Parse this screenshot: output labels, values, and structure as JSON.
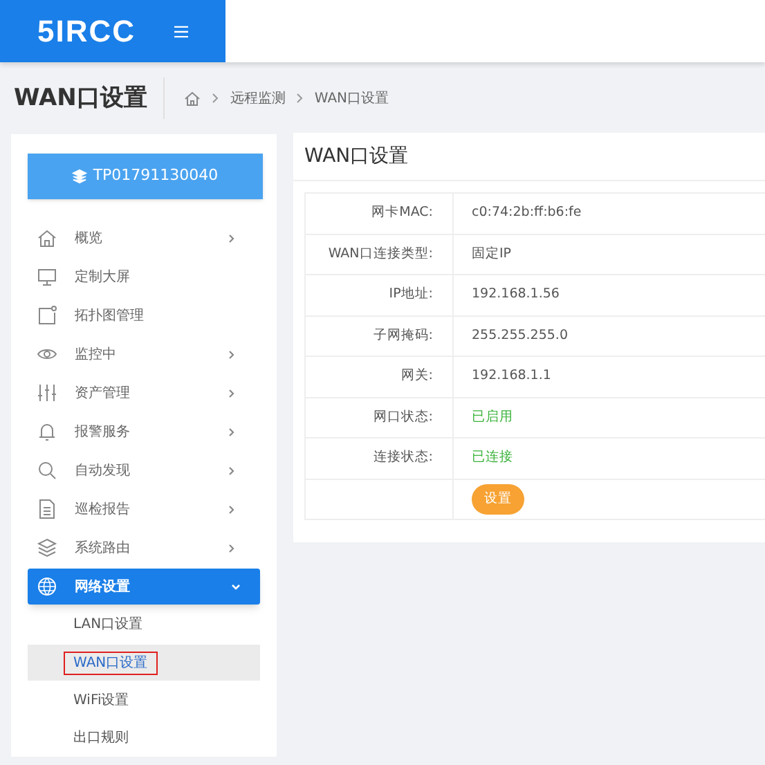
{
  "header": {
    "logo": "5IRCC"
  },
  "page_title": "WAN口设置",
  "breadcrumb": [
    "远程监测",
    "WAN口设置"
  ],
  "device_button": "TP01791130040",
  "sidebar": {
    "items": [
      {
        "label": "概览",
        "has_arrow": true,
        "expanded": false
      },
      {
        "label": "定制大屏",
        "has_arrow": false,
        "expanded": false
      },
      {
        "label": "拓扑图管理",
        "has_arrow": false,
        "expanded": false
      },
      {
        "label": "监控中",
        "has_arrow": true,
        "expanded": false
      },
      {
        "label": "资产管理",
        "has_arrow": true,
        "expanded": false
      },
      {
        "label": "报警服务",
        "has_arrow": true,
        "expanded": false
      },
      {
        "label": "自动发现",
        "has_arrow": true,
        "expanded": false
      },
      {
        "label": "巡检报告",
        "has_arrow": true,
        "expanded": false
      },
      {
        "label": "系统路由",
        "has_arrow": true,
        "expanded": false
      },
      {
        "label": "网络设置",
        "has_arrow": true,
        "expanded": true,
        "children": [
          {
            "label": "LAN口设置",
            "selected": false
          },
          {
            "label": "WAN口设置",
            "selected": true
          },
          {
            "label": "WiFi设置",
            "selected": false
          },
          {
            "label": "出口规则",
            "selected": false
          }
        ]
      }
    ]
  },
  "card": {
    "title": "WAN口设置",
    "rows": [
      {
        "kind": "text",
        "label": "网卡MAC:",
        "value": "c0:74:2b:ff:b6:fe"
      },
      {
        "kind": "text",
        "label": "WAN口连接类型:",
        "value": "固定IP"
      },
      {
        "kind": "text",
        "label": "IP地址:",
        "value": "192.168.1.56"
      },
      {
        "kind": "text",
        "label": "子网掩码:",
        "value": "255.255.255.0"
      },
      {
        "kind": "text",
        "label": "网关:",
        "value": "192.168.1.1"
      },
      {
        "kind": "status",
        "label": "网口状态:",
        "value": "已启用"
      },
      {
        "kind": "status",
        "label": "连接状态:",
        "value": "已连接"
      },
      {
        "kind": "button",
        "value": "设置"
      }
    ]
  }
}
